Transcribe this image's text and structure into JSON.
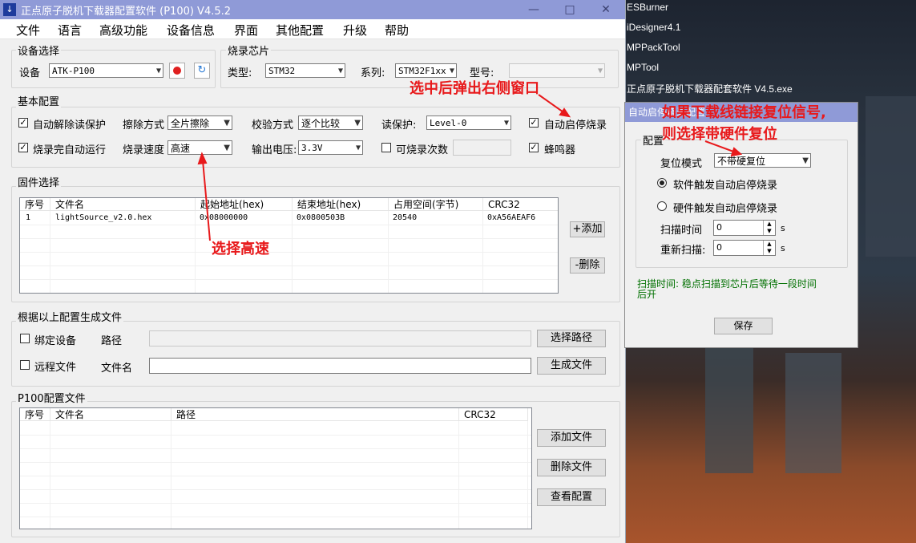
{
  "window": {
    "title": "正点原子脱机下载器配置软件 (P100)  V4.5.2",
    "min": "▭",
    "max": "□",
    "close": "✕"
  },
  "menu": [
    "文件",
    "语言",
    "高级功能",
    "设备信息",
    "界面",
    "其他配置",
    "升级",
    "帮助"
  ],
  "device_group": {
    "title": "设备选择",
    "label": "设备",
    "value": "ATK-P100"
  },
  "chip_group": {
    "title": "烧录芯片",
    "type_label": "类型:",
    "type_value": "STM32",
    "series_label": "系列:",
    "series_value": "STM32F1xx",
    "model_label": "型号:",
    "model_value": ""
  },
  "basic": {
    "title": "基本配置",
    "auto_unprotect": "自动解除读保护",
    "auto_run": "烧录完自动运行",
    "erase_label": "擦除方式",
    "erase_value": "全片擦除",
    "speed_label": "烧录速度",
    "speed_value": "高速",
    "verify_label": "校验方式",
    "verify_value": "逐个比较",
    "voltage_label": "输出电压:",
    "voltage_value": "3.3V",
    "readprot_label": "读保护:",
    "readprot_value": "Level-0",
    "count_label": "可烧录次数",
    "auto_start": "自动启停烧录",
    "buzzer": "蜂鸣器"
  },
  "firmware": {
    "title": "固件选择",
    "headers": [
      "序号",
      "文件名",
      "起始地址(hex)",
      "结束地址(hex)",
      "占用空间(字节)",
      "CRC32"
    ],
    "rows": [
      [
        "1",
        "lightSource_v2.0.hex",
        "0x08000000",
        "0x0800503B",
        "20540",
        "0xA56AEAF6"
      ]
    ],
    "add": "+添加",
    "del": "-删除"
  },
  "generate": {
    "title": "根据以上配置生成文件",
    "bind": "绑定设备",
    "path_label": "路径",
    "choose_path": "选择路径",
    "remote": "远程文件",
    "filename_label": "文件名",
    "gen": "生成文件"
  },
  "p100": {
    "title": "P100配置文件",
    "headers": [
      "序号",
      "文件名",
      "路径",
      "CRC32"
    ],
    "add": "添加文件",
    "del": "删除文件",
    "view": "查看配置"
  },
  "popup": {
    "title": "自动启停烧录配置",
    "group": "配置",
    "reset_label": "复位模式",
    "reset_value": "不带硬复位",
    "opt_soft": "软件触发自动启停烧录",
    "opt_hard": "硬件触发自动启停烧录",
    "scan_label": "扫描时间",
    "scan_value": "0",
    "rescan_label": "重新扫描:",
    "rescan_value": "0",
    "unit": "s",
    "hint1": "扫描时间: 稳点扫描到芯片后等待一段时间",
    "hint2": "后开",
    "save": "保存"
  },
  "desktop": {
    "icons": [
      "ESBurner",
      "iDesigner4.1",
      "MPPackTool",
      "MPTool",
      "正点原子脱机下载器配套软件 V4.5.exe"
    ]
  },
  "annotations": {
    "a1": "选中后弹出右侧窗口",
    "a2": "选择高速",
    "a3": "如果下载线链接复位信号,",
    "a4": "则选择带硬件复位"
  },
  "colors": {
    "annotation": "#e8191b",
    "titlebar": "#8f9ad7",
    "hint": "#007000"
  }
}
